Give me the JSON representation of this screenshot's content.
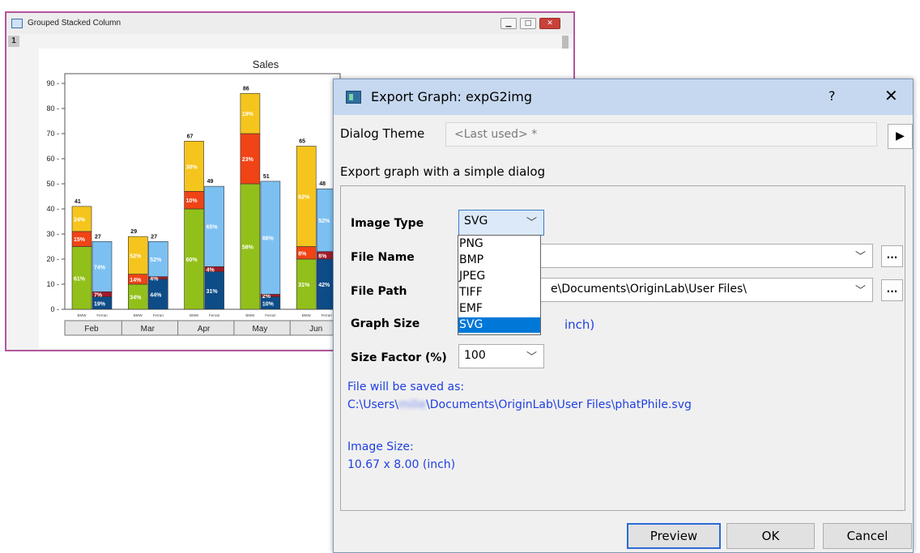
{
  "graph_window": {
    "title": "Grouped Stacked Column",
    "layer_tab": "1"
  },
  "chart_data": {
    "type": "bar",
    "stacked": true,
    "grouped": true,
    "title": "Sales",
    "xlabel": "",
    "ylabel": "",
    "ylim": [
      0,
      90
    ],
    "yticks": [
      0,
      10,
      20,
      30,
      40,
      50,
      60,
      70,
      80,
      90
    ],
    "categories": [
      "Feb",
      "Mar",
      "Apr",
      "May",
      "Jun"
    ],
    "group_labels": [
      "BMW",
      "Ferrari"
    ],
    "groups": [
      {
        "name": "BMW",
        "totals": [
          41,
          29,
          67,
          86,
          65
        ],
        "segment_colors": [
          "#92c01a",
          "#f04316",
          "#f5c51d"
        ],
        "segments": [
          {
            "values": [
              25,
              10,
              40,
              50,
              20
            ],
            "labels": [
              "61%",
              "34%",
              "60%",
              "58%",
              "31%"
            ]
          },
          {
            "values": [
              6,
              4,
              7,
              20,
              5
            ],
            "labels": [
              "15%",
              "14%",
              "10%",
              "23%",
              "8%"
            ]
          },
          {
            "values": [
              10,
              15,
              20,
              16,
              40
            ],
            "labels": [
              "24%",
              "52%",
              "30%",
              "19%",
              "62%"
            ]
          }
        ]
      },
      {
        "name": "Ferrari",
        "totals": [
          27,
          27,
          49,
          51,
          48
        ],
        "segment_colors": [
          "#0d4c87",
          "#a11a2a",
          "#7cc0f2"
        ],
        "segments": [
          {
            "values": [
              5,
              12,
              15,
              5,
              20
            ],
            "labels": [
              "19%",
              "44%",
              "31%",
              "10%",
              "42%"
            ]
          },
          {
            "values": [
              2,
              1,
              2,
              1,
              3
            ],
            "labels": [
              "7%",
              "4%",
              "4%",
              "2%",
              "6%"
            ]
          },
          {
            "values": [
              20,
              14,
              32,
              45,
              25
            ],
            "labels": [
              "74%",
              "52%",
              "65%",
              "88%",
              "52%"
            ]
          }
        ]
      }
    ]
  },
  "dialog": {
    "title": "Export Graph: expG2img",
    "help": "?",
    "close": "✕",
    "theme_label": "Dialog Theme",
    "theme_value": "<Last used> *",
    "theme_arrow": "▶",
    "simple_text": "Export graph with a simple dialog",
    "image_type_label": "Image Type",
    "image_type_value": "SVG",
    "image_type_options": [
      "PNG",
      "BMP",
      "JPEG",
      "TIFF",
      "EMF",
      "SVG"
    ],
    "image_type_selected": "SVG",
    "file_name_label": "File Name",
    "file_name_value": "",
    "file_path_label": "File Path",
    "file_path_visible": "e\\Documents\\OriginLab\\User Files\\",
    "graph_size_label": "Graph Size",
    "graph_size_visible": "inch)",
    "size_factor_label": "Size Factor (%)",
    "size_factor_value": "100",
    "ellipsis": "...",
    "saved_as_label": "File will be saved as:",
    "saved_as_prefix": "C:\\Users\\",
    "saved_as_user": "milie",
    "saved_as_suffix": "\\Documents\\OriginLab\\User Files\\phatPhile.svg",
    "image_size_label": "Image Size:",
    "image_size_value": "10.67 x 8.00 (inch)",
    "buttons": {
      "preview": "Preview",
      "ok": "OK",
      "cancel": "Cancel"
    }
  }
}
